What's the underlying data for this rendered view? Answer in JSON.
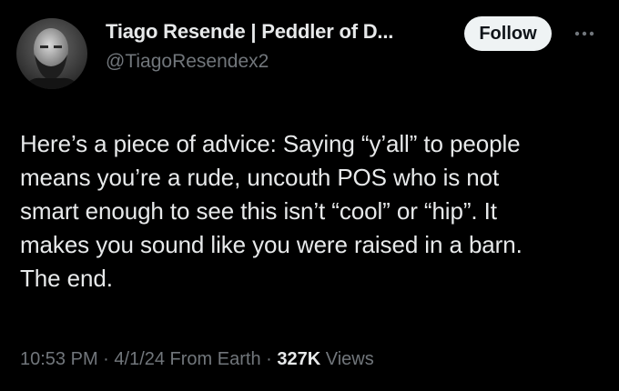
{
  "author": {
    "display_name": "Tiago Resende | Peddler of D...",
    "handle": "@TiagoResendex2"
  },
  "actions": {
    "follow_label": "Follow",
    "more_icon": "more-horizontal-icon"
  },
  "tweet": {
    "text": "Here’s a piece of advice: Saying “y’all” to people\nmeans you’re a rude, uncouth POS who is not\nsmart enough to see this isn’t “cool” or “hip”. It\nmakes you sound like you were raised in a barn.\nThe end."
  },
  "meta": {
    "time": "10:53 PM",
    "sep1": " · ",
    "date": "4/1/24",
    "source": " From Earth",
    "sep2": " · ",
    "views_count": "327K",
    "views_label": " Views"
  },
  "colors": {
    "background": "#000000",
    "primary_text": "#e7e9ea",
    "secondary_text": "#71767b",
    "follow_bg": "#eff3f4"
  }
}
